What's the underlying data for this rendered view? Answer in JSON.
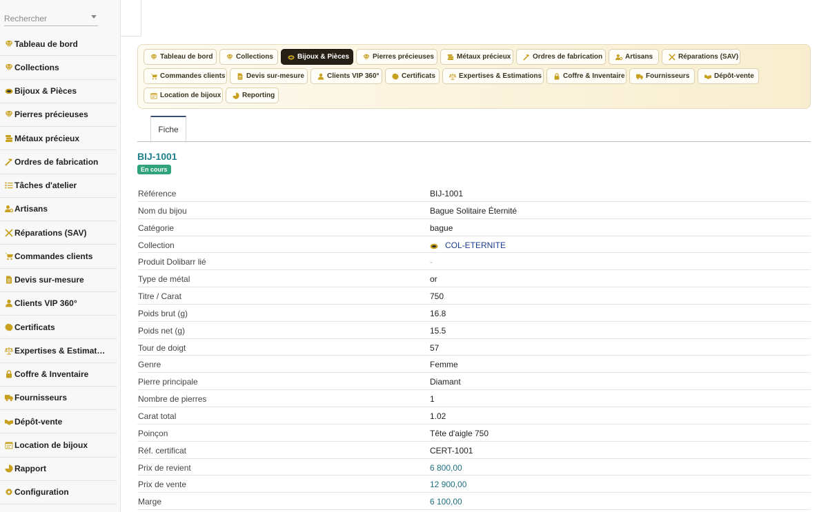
{
  "sidebar": {
    "search_placeholder": "Rechercher",
    "items": [
      {
        "label": "Tableau de bord",
        "icon": "gem-icon"
      },
      {
        "label": "Collections",
        "icon": "gem-icon"
      },
      {
        "label": "Bijoux & Pièces",
        "icon": "ring-icon"
      },
      {
        "label": "Pierres précieuses",
        "icon": "gem-icon"
      },
      {
        "label": "Métaux précieux",
        "icon": "coins-icon"
      },
      {
        "label": "Ordres de fabrication",
        "icon": "hammer-icon"
      },
      {
        "label": "Tâches d'atelier",
        "icon": "list-icon"
      },
      {
        "label": "Artisans",
        "icon": "users-cog-icon"
      },
      {
        "label": "Réparations (SAV)",
        "icon": "tools-icon"
      },
      {
        "label": "Commandes clients",
        "icon": "cart-icon"
      },
      {
        "label": "Devis sur-mesure",
        "icon": "file-icon"
      },
      {
        "label": "Clients VIP 360°",
        "icon": "user-icon"
      },
      {
        "label": "Certificats",
        "icon": "certificate-icon"
      },
      {
        "label": "Expertises & Estimat…",
        "icon": "balance-icon"
      },
      {
        "label": "Coffre & Inventaire",
        "icon": "lock-icon"
      },
      {
        "label": "Fournisseurs",
        "icon": "truck-icon"
      },
      {
        "label": "Dépôt-vente",
        "icon": "handshake-icon"
      },
      {
        "label": "Location de bijoux",
        "icon": "calendar-icon"
      },
      {
        "label": "Rapport",
        "icon": "pie-icon"
      },
      {
        "label": "Configuration",
        "icon": "gear-icon"
      }
    ]
  },
  "module_tabs": [
    {
      "label": "Tableau de bord",
      "icon": "gem-icon"
    },
    {
      "label": "Collections",
      "icon": "gem-icon"
    },
    {
      "label": "Bijoux & Pièces",
      "icon": "ring-icon",
      "active": true
    },
    {
      "label": "Pierres précieuses",
      "icon": "gem-icon"
    },
    {
      "label": "Métaux précieux",
      "icon": "coins-icon"
    },
    {
      "label": "Ordres de fabrication",
      "icon": "hammer-icon"
    },
    {
      "label": "Artisans",
      "icon": "users-cog-icon"
    },
    {
      "label": "Réparations (SAV)",
      "icon": "tools-icon"
    },
    {
      "label": "Commandes clients",
      "icon": "cart-icon"
    },
    {
      "label": "Devis sur-mesure",
      "icon": "file-icon"
    },
    {
      "label": "Clients VIP 360°",
      "icon": "user-icon"
    },
    {
      "label": "Certificats",
      "icon": "certificate-icon"
    },
    {
      "label": "Expertises & Estimations",
      "icon": "balance-icon"
    },
    {
      "label": "Coffre & Inventaire",
      "icon": "lock-icon"
    },
    {
      "label": "Fournisseurs",
      "icon": "truck-icon"
    },
    {
      "label": "Dépôt-vente",
      "icon": "handshake-icon"
    },
    {
      "label": "Location de bijoux",
      "icon": "calendar-icon"
    },
    {
      "label": "Reporting",
      "icon": "pie-icon"
    }
  ],
  "record_tab": "Fiche",
  "record": {
    "ref": "BIJ-1001",
    "status": "En cours",
    "status_color": "#2fa37a",
    "fields": [
      {
        "label": "Référence",
        "value": "BIJ-1001"
      },
      {
        "label": "Nom du bijou",
        "value": "Bague Solitaire Éternité"
      },
      {
        "label": "Catégorie",
        "value": "bague"
      },
      {
        "label": "Collection",
        "value": "COL-ETERNITE",
        "kind": "link"
      },
      {
        "label": "Produit Dolibarr lié",
        "value": "-",
        "kind": "muted"
      },
      {
        "label": "Type de métal",
        "value": "or"
      },
      {
        "label": "Titre / Carat",
        "value": "750"
      },
      {
        "label": "Poids brut (g)",
        "value": "16.8"
      },
      {
        "label": "Poids net (g)",
        "value": "15.5"
      },
      {
        "label": "Tour de doigt",
        "value": "57"
      },
      {
        "label": "Genre",
        "value": "Femme"
      },
      {
        "label": "Pierre principale",
        "value": "Diamant"
      },
      {
        "label": "Nombre de pierres",
        "value": "1"
      },
      {
        "label": "Carat total",
        "value": "1.02"
      },
      {
        "label": "Poinçon",
        "value": "Tête d'aigle 750"
      },
      {
        "label": "Réf. certificat",
        "value": "CERT-1001"
      },
      {
        "label": "Prix de revient",
        "value": "6 800,00",
        "kind": "money"
      },
      {
        "label": "Prix de vente",
        "value": "12 900,00",
        "kind": "money"
      },
      {
        "label": "Marge",
        "value": "6 100,00",
        "kind": "money"
      }
    ]
  },
  "colors": {
    "accent_gold": "#c8a020",
    "active_tab": "#272017",
    "money": "#1d6f80",
    "link": "#1a3a8a"
  }
}
